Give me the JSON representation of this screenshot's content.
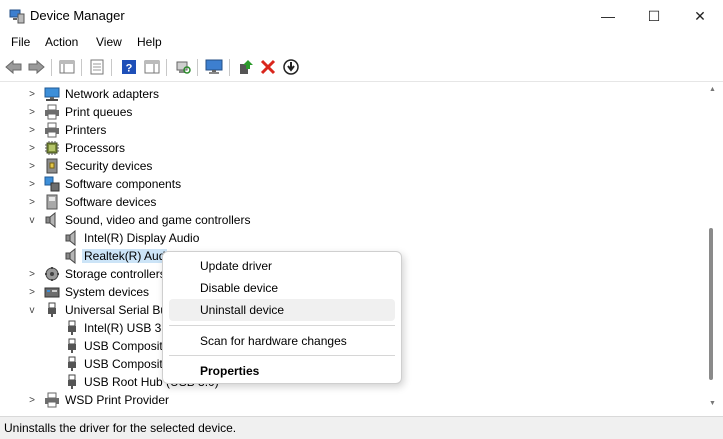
{
  "window": {
    "title": "Device Manager",
    "minimize": "—",
    "maximize": "☐",
    "close": "✕"
  },
  "menu": [
    "File",
    "Action",
    "View",
    "Help"
  ],
  "tree": [
    {
      "label": "Network adapters",
      "level": 1,
      "expander": ">",
      "icon": "network-adapter-icon"
    },
    {
      "label": "Print queues",
      "level": 1,
      "expander": ">",
      "icon": "printer-icon"
    },
    {
      "label": "Printers",
      "level": 1,
      "expander": ">",
      "icon": "printer-icon"
    },
    {
      "label": "Processors",
      "level": 1,
      "expander": ">",
      "icon": "processor-icon"
    },
    {
      "label": "Security devices",
      "level": 1,
      "expander": ">",
      "icon": "security-device-icon"
    },
    {
      "label": "Software components",
      "level": 1,
      "expander": ">",
      "icon": "software-component-icon"
    },
    {
      "label": "Software devices",
      "level": 1,
      "expander": ">",
      "icon": "software-device-icon"
    },
    {
      "label": "Sound, video and game controllers",
      "level": 1,
      "expander": "v",
      "icon": "speaker-icon"
    },
    {
      "label": "Intel(R) Display Audio",
      "level": 2,
      "expander": "",
      "icon": "speaker-icon"
    },
    {
      "label": "Realtek(R) Aud",
      "level": 2,
      "expander": "",
      "icon": "speaker-icon",
      "selected": true
    },
    {
      "label": "Storage controllers",
      "level": 1,
      "expander": ">",
      "icon": "storage-controller-icon"
    },
    {
      "label": "System devices",
      "level": 1,
      "expander": ">",
      "icon": "system-device-icon"
    },
    {
      "label": "Universal Serial Bu",
      "level": 1,
      "expander": "v",
      "icon": "usb-icon"
    },
    {
      "label": "Intel(R) USB 3.0",
      "level": 2,
      "expander": "",
      "icon": "usb-icon"
    },
    {
      "label": "USB Composite",
      "level": 2,
      "expander": "",
      "icon": "usb-icon"
    },
    {
      "label": "USB Composite",
      "level": 2,
      "expander": "",
      "icon": "usb-icon"
    },
    {
      "label": "USB Root Hub (USB 3.0)",
      "level": 2,
      "expander": "",
      "icon": "usb-icon"
    },
    {
      "label": "WSD Print Provider",
      "level": 1,
      "expander": ">",
      "icon": "printer-icon"
    }
  ],
  "context_menu": {
    "update_driver": "Update driver",
    "disable_device": "Disable device",
    "uninstall_device": "Uninstall device",
    "scan_hardware": "Scan for hardware changes",
    "properties": "Properties"
  },
  "status_bar": {
    "text": "Uninstalls the driver for the selected device."
  },
  "colors": {
    "selection": "#cce4f7",
    "menu_hover": "#f0f0f0",
    "delete_red": "#d9261c",
    "help_blue": "#1e4fb8"
  }
}
